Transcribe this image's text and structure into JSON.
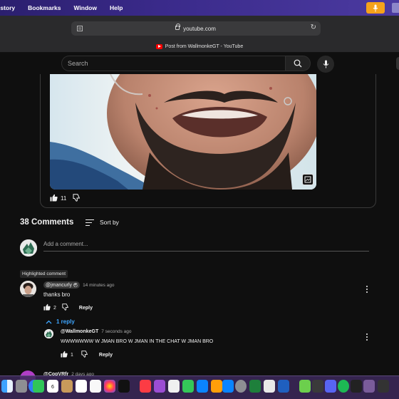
{
  "menubar": {
    "items": [
      "istory",
      "Bookmarks",
      "Window",
      "Help"
    ],
    "accent": "#f5a21b"
  },
  "browser": {
    "url": "youtube.com",
    "tab_title": "Post from WallmonkeGT - YouTube"
  },
  "youtube": {
    "search_placeholder": "Search"
  },
  "post": {
    "likes": "11"
  },
  "comments": {
    "count_label": "38 Comments",
    "sort_label": "Sort by",
    "add_placeholder": "Add a comment...",
    "highlighted_label": "Highlighted comment",
    "items": [
      {
        "handle": "@jmancurly",
        "time": "14 minutes ago",
        "text": "thanks bro",
        "likes": "2",
        "reply_label": "Reply",
        "replies_toggle": "1 reply",
        "replies": [
          {
            "handle": "@WallmonkeGT",
            "time": "7 seconds ago",
            "text": "WWWWWWW W JMAN BRO W JMAN IN THE CHAT W JMAN BRO",
            "likes": "1",
            "reply_label": "Reply"
          }
        ]
      },
      {
        "handle": "@CopVRfr",
        "time": "2 days ago"
      }
    ]
  },
  "dock": {
    "calendar_day": "6"
  }
}
